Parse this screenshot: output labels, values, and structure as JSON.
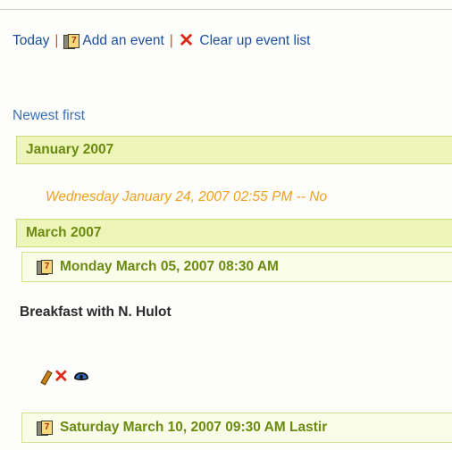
{
  "toolbar": {
    "today": "Today",
    "separator": "|",
    "add_event": "Add an event",
    "clear_list": "Clear up event list",
    "add_icon": "calendar-icon",
    "clear_icon": "red-x-icon"
  },
  "sort_label": "Newest first",
  "months": [
    {
      "label": "January 2007",
      "events": [
        {
          "title": "Wednesday January 24, 2007 02:55 PM -- No"
        }
      ]
    },
    {
      "label": "March 2007",
      "events": [
        {
          "title": "Monday March 05, 2007 08:30 AM",
          "description": "Breakfast with N. Hulot",
          "actions": [
            "pencil-icon",
            "delete-x-icon",
            "eye-icon"
          ]
        },
        {
          "title": "Saturday March 10, 2007 09:30 AM Lastir"
        }
      ]
    }
  ],
  "colors": {
    "link_blue": "#1d4f9a",
    "month_bar_bg": "#eef5b8",
    "month_text": "#6b8a10",
    "highlight_orange": "#f0a020",
    "delete_red": "#e0281a"
  }
}
